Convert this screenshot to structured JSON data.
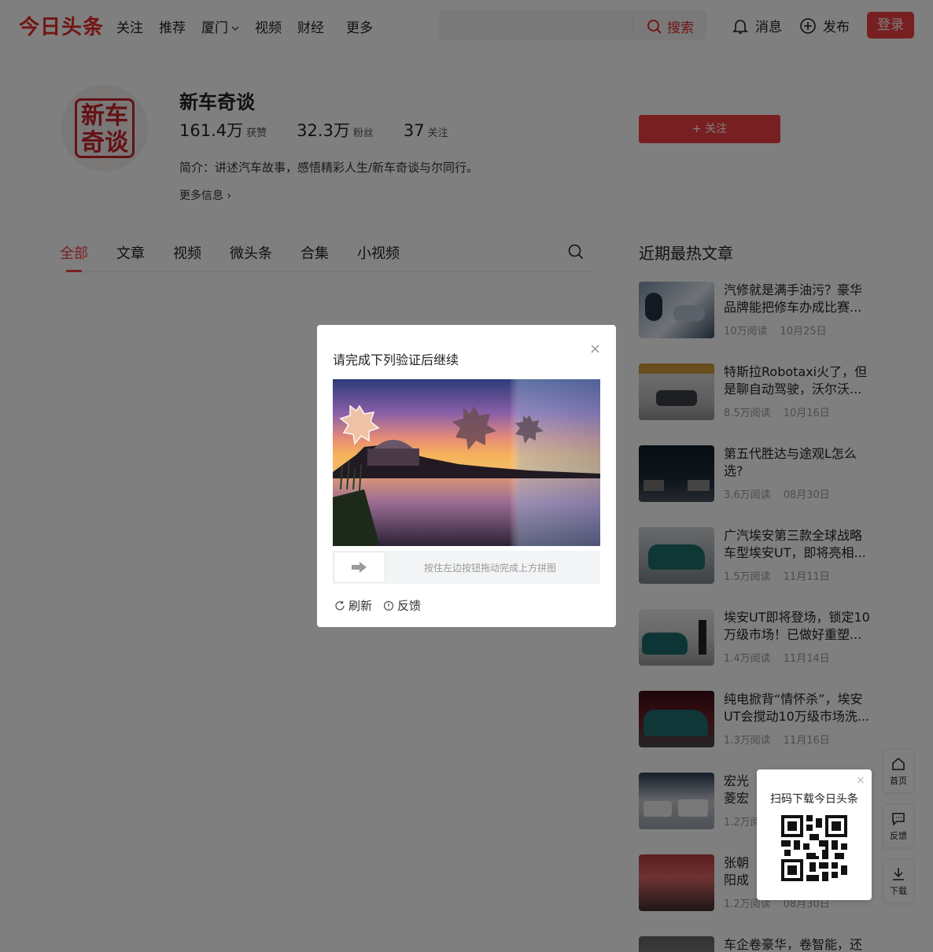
{
  "header": {
    "logo": "今日头条",
    "nav": [
      "关注",
      "推荐",
      "厦门",
      "视频",
      "财经",
      "更多"
    ],
    "search_label": "搜索",
    "messages": "消息",
    "publish": "发布",
    "login": "登录"
  },
  "profile": {
    "name": "新车奇谈",
    "avatar_text": "新车奇谈",
    "likes": "161.4万",
    "likes_label": "获赞",
    "fans": "32.3万",
    "fans_label": "粉丝",
    "following": "37",
    "following_label": "关注",
    "intro": "简介：讲述汽车故事，感悟精彩人生/新车奇谈与尔同行。",
    "more_info": "更多信息 ›",
    "follow_button": "+ 关注"
  },
  "tabs": [
    "全部",
    "文章",
    "视频",
    "微头条",
    "合集",
    "小视频"
  ],
  "hot": {
    "title": "近期最热文章",
    "articles": [
      {
        "title": "汽修就是满手油污？豪华品牌能把修车办成比赛...",
        "reads": "10万阅读",
        "date": "10月25日"
      },
      {
        "title": "特斯拉Robotaxi火了，但是聊自动驾驶，沃尔沃...",
        "reads": "8.5万阅读",
        "date": "10月16日"
      },
      {
        "title": "第五代胜达与途观L怎么选?",
        "reads": "3.6万阅读",
        "date": "08月30日"
      },
      {
        "title": "广汽埃安第三款全球战略车型埃安UT，即将亮相...",
        "reads": "1.5万阅读",
        "date": "11月11日"
      },
      {
        "title": "埃安UT即将登场，锁定10万级市场！已做好重塑...",
        "reads": "1.4万阅读",
        "date": "11月14日"
      },
      {
        "title": "纯电掀背“情怀杀”，埃安UT会搅动10万级市场洗...",
        "reads": "1.3万阅读",
        "date": "11月16日"
      },
      {
        "title": "宏光菱宏光",
        "reads": "1.2万阅",
        "date": ""
      },
      {
        "title": "张朝阳成都车",
        "reads": "1.2万阅读",
        "date": "08月30日"
      },
      {
        "title": "车企卷豪华，卷智能，还",
        "reads": "",
        "date": ""
      }
    ]
  },
  "captcha": {
    "title": "请完成下列验证后继续",
    "close": "×",
    "slider_hint": "按住左边按钮拖动完成上方拼图",
    "refresh": "刷新",
    "feedback": "反馈"
  },
  "qr_popup": {
    "text": "扫码下载今日头条",
    "close": "×"
  },
  "side_tools": [
    "首页",
    "反馈",
    "下载"
  ],
  "colors": {
    "brand": "#f04142",
    "logo": "#e62a2a"
  }
}
